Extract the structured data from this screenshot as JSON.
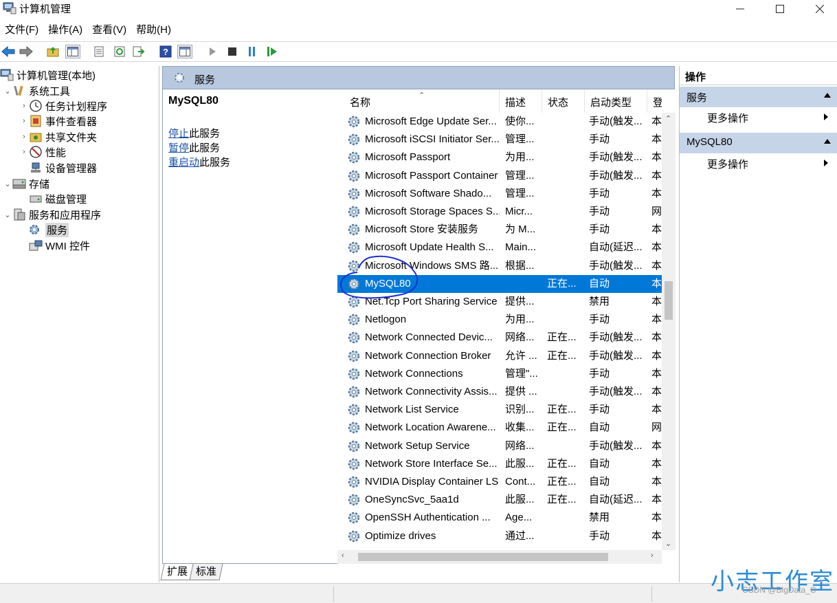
{
  "window": {
    "title": "计算机管理"
  },
  "menubar": [
    "文件(F)",
    "操作(A)",
    "查看(V)",
    "帮助(H)"
  ],
  "tree": {
    "root": "计算机管理(本地)",
    "system_tools": "系统工具",
    "task_scheduler": "任务计划程序",
    "event_viewer": "事件查看器",
    "shared_folders": "共享文件夹",
    "performance": "性能",
    "device_manager": "设备管理器",
    "storage": "存储",
    "disk_management": "磁盘管理",
    "services_apps": "服务和应用程序",
    "services": "服务",
    "wmi": "WMI 控件"
  },
  "center": {
    "header": "服务",
    "selected_service": "MySQL80",
    "links": [
      {
        "link": "停止",
        "rest": "此服务"
      },
      {
        "link": "暂停",
        "rest": "此服务"
      },
      {
        "link": "重启动",
        "rest": "此服务"
      }
    ],
    "columns": [
      "名称",
      "描述",
      "状态",
      "启动类型",
      "登"
    ],
    "rows": [
      {
        "name": "Microsoft Edge Update Ser...",
        "desc": "使你...",
        "status": "",
        "startup": "手动(触发...",
        "logon": "本"
      },
      {
        "name": "Microsoft iSCSI Initiator Ser...",
        "desc": "管理...",
        "status": "",
        "startup": "手动",
        "logon": "本"
      },
      {
        "name": "Microsoft Passport",
        "desc": "为用...",
        "status": "",
        "startup": "手动(触发...",
        "logon": "本"
      },
      {
        "name": "Microsoft Passport Container",
        "desc": "管理...",
        "status": "",
        "startup": "手动(触发...",
        "logon": "本"
      },
      {
        "name": "Microsoft Software Shado...",
        "desc": "管理...",
        "status": "",
        "startup": "手动",
        "logon": "本"
      },
      {
        "name": "Microsoft Storage Spaces S...",
        "desc": "Micr...",
        "status": "",
        "startup": "手动",
        "logon": "网"
      },
      {
        "name": "Microsoft Store 安装服务",
        "desc": "为 M...",
        "status": "",
        "startup": "手动",
        "logon": "本"
      },
      {
        "name": "Microsoft Update Health S...",
        "desc": "Main...",
        "status": "",
        "startup": "自动(延迟...",
        "logon": "本"
      },
      {
        "name": "Microsoft Windows SMS 路...",
        "desc": "根据...",
        "status": "",
        "startup": "手动(触发...",
        "logon": "本"
      },
      {
        "name": "MySQL80",
        "desc": "",
        "status": "正在...",
        "startup": "自动",
        "logon": "本"
      },
      {
        "name": "Net.Tcp Port Sharing Service",
        "desc": "提供...",
        "status": "",
        "startup": "禁用",
        "logon": "本"
      },
      {
        "name": "Netlogon",
        "desc": "为用...",
        "status": "",
        "startup": "手动",
        "logon": "本"
      },
      {
        "name": "Network Connected Devic...",
        "desc": "网络...",
        "status": "正在...",
        "startup": "手动(触发...",
        "logon": "本"
      },
      {
        "name": "Network Connection Broker",
        "desc": "允许 ...",
        "status": "正在...",
        "startup": "手动(触发...",
        "logon": "本"
      },
      {
        "name": "Network Connections",
        "desc": "管理\"...",
        "status": "",
        "startup": "手动",
        "logon": "本"
      },
      {
        "name": "Network Connectivity Assis...",
        "desc": "提供 ...",
        "status": "",
        "startup": "手动(触发...",
        "logon": "本"
      },
      {
        "name": "Network List Service",
        "desc": "识别...",
        "status": "正在...",
        "startup": "手动",
        "logon": "本"
      },
      {
        "name": "Network Location Awarene...",
        "desc": "收集...",
        "status": "正在...",
        "startup": "自动",
        "logon": "网"
      },
      {
        "name": "Network Setup Service",
        "desc": "网络...",
        "status": "",
        "startup": "手动(触发...",
        "logon": "本"
      },
      {
        "name": "Network Store Interface Se...",
        "desc": "此服...",
        "status": "正在...",
        "startup": "自动",
        "logon": "本"
      },
      {
        "name": "NVIDIA Display Container LS",
        "desc": "Cont...",
        "status": "正在...",
        "startup": "自动",
        "logon": "本"
      },
      {
        "name": "OneSyncSvc_5aa1d",
        "desc": "此服...",
        "status": "正在...",
        "startup": "自动(延迟...",
        "logon": "本"
      },
      {
        "name": "OpenSSH Authentication ...",
        "desc": "Age...",
        "status": "",
        "startup": "禁用",
        "logon": "本"
      },
      {
        "name": "Optimize drives",
        "desc": "通过...",
        "status": "",
        "startup": "手动",
        "logon": "本"
      }
    ],
    "selected_index": 9
  },
  "tabs": [
    "扩展",
    "标准"
  ],
  "actions": {
    "title": "操作",
    "groups": [
      {
        "label": "服务",
        "item": "更多操作"
      },
      {
        "label": "MySQL80",
        "item": "更多操作"
      }
    ]
  },
  "watermark": {
    "brand": "小志工作室",
    "csdn": "CSDN @BigData_C"
  },
  "colors": {
    "selection": "#0078d7",
    "header_bg": "#b8c8de",
    "group_bg": "#c6d4e8",
    "annotation": "#1a2fd0"
  }
}
